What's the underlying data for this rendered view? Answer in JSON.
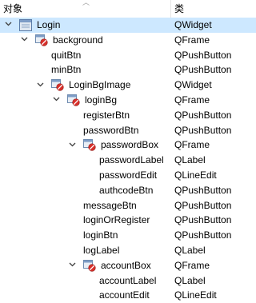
{
  "header": {
    "object_col": "对象",
    "class_col": "类"
  },
  "rows": [
    {
      "name": "Login",
      "cls": "QWidget",
      "expanded": true,
      "icon": "form-icon"
    },
    {
      "name": "background",
      "cls": "QFrame",
      "expanded": true,
      "icon": "frame-widget-icon"
    },
    {
      "name": "quitBtn",
      "cls": "QPushButton"
    },
    {
      "name": "minBtn",
      "cls": "QPushButton"
    },
    {
      "name": "LoginBgImage",
      "cls": "QWidget",
      "expanded": true,
      "icon": "frame-widget-icon"
    },
    {
      "name": "loginBg",
      "cls": "QFrame",
      "expanded": true,
      "icon": "frame-widget-icon"
    },
    {
      "name": "registerBtn",
      "cls": "QPushButton"
    },
    {
      "name": "passwordBtn",
      "cls": "QPushButton"
    },
    {
      "name": "passwordBox",
      "cls": "QFrame",
      "expanded": true,
      "icon": "frame-widget-icon"
    },
    {
      "name": "passwordLabel",
      "cls": "QLabel"
    },
    {
      "name": "passwordEdit",
      "cls": "QLineEdit"
    },
    {
      "name": "authcodeBtn",
      "cls": "QPushButton"
    },
    {
      "name": "messageBtn",
      "cls": "QPushButton"
    },
    {
      "name": "loginOrRegister",
      "cls": "QPushButton"
    },
    {
      "name": "loginBtn",
      "cls": "QPushButton"
    },
    {
      "name": "logLabel",
      "cls": "QLabel"
    },
    {
      "name": "accountBox",
      "cls": "QFrame",
      "expanded": true,
      "icon": "frame-widget-icon"
    },
    {
      "name": "accountLabel",
      "cls": "QLabel"
    },
    {
      "name": "accountEdit",
      "cls": "QLineEdit"
    }
  ]
}
